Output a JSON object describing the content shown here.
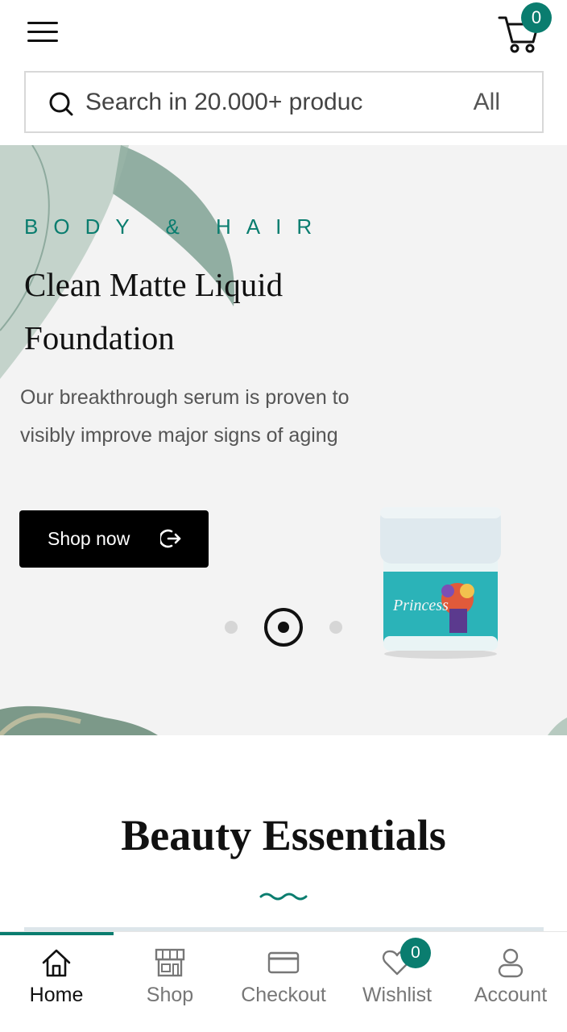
{
  "header": {
    "cart_count": "0",
    "search": {
      "placeholder": "Search in 20.000+ produc",
      "category": "All"
    }
  },
  "hero": {
    "eyebrow": "BODY & HAIR",
    "title": "Clean Matte Liquid Foundation",
    "description": "Our breakthrough serum is proven to visibly improve major signs of aging",
    "cta_label": "Shop now",
    "product_label": "Princess",
    "slides_total": 3,
    "slide_active": 2
  },
  "section": {
    "title": "Beauty Essentials"
  },
  "bottom_nav": {
    "items": [
      {
        "label": "Home",
        "icon": "home-icon",
        "active": true
      },
      {
        "label": "Shop",
        "icon": "store-icon",
        "active": false
      },
      {
        "label": "Checkout",
        "icon": "credit-card-icon",
        "active": false
      },
      {
        "label": "Wishlist",
        "icon": "heart-icon",
        "active": false
      },
      {
        "label": "Account",
        "icon": "user-icon",
        "active": false
      }
    ],
    "wishlist_count": "0"
  },
  "colors": {
    "accent": "#0a7d6f",
    "hero_bg": "#f3f3f3",
    "button_bg": "#000000"
  }
}
